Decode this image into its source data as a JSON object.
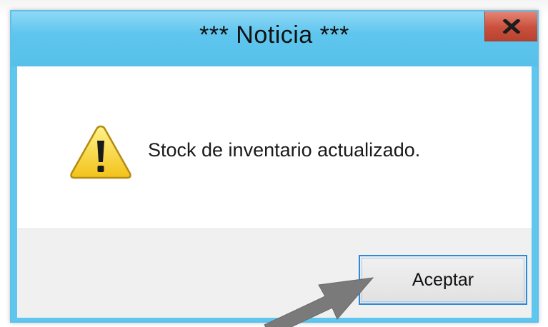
{
  "dialog": {
    "title": "*** Noticia ***",
    "close_label": "x",
    "message": "Stock de inventario actualizado.",
    "icon": "warning-icon",
    "accept_label": "Aceptar"
  },
  "colors": {
    "titlebar": "#5fc6ee",
    "close_button": "#c9503c",
    "footer": "#f0f0f0",
    "focus_border": "#2e8ad8",
    "annotation_arrow": "#7a7a7a"
  },
  "annotation": {
    "type": "arrow",
    "points_to": "accept-button"
  }
}
